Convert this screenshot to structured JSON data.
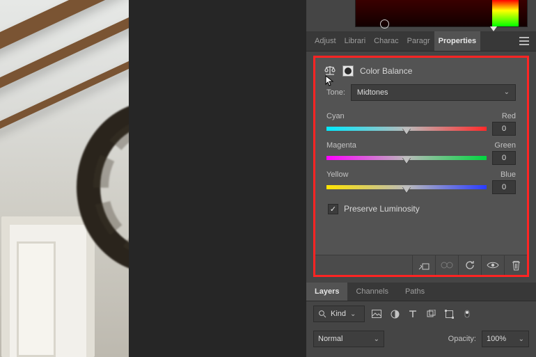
{
  "tabs": {
    "adjustments": "Adjust",
    "libraries": "Librari",
    "character": "Charac",
    "paragraph": "Paragr",
    "properties": "Properties"
  },
  "properties": {
    "title": "Color Balance",
    "tone_label": "Tone:",
    "tone_value": "Midtones",
    "sliders": {
      "cr": {
        "left": "Cyan",
        "right": "Red",
        "value": "0"
      },
      "mg": {
        "left": "Magenta",
        "right": "Green",
        "value": "0"
      },
      "yb": {
        "left": "Yellow",
        "right": "Blue",
        "value": "0"
      }
    },
    "preserve_label": "Preserve Luminosity",
    "preserve_checked": "✓"
  },
  "layers": {
    "tabs": {
      "layers": "Layers",
      "channels": "Channels",
      "paths": "Paths"
    },
    "filter_label": "Kind",
    "blend_mode": "Normal",
    "opacity_label": "Opacity:",
    "opacity_value": "100%"
  }
}
